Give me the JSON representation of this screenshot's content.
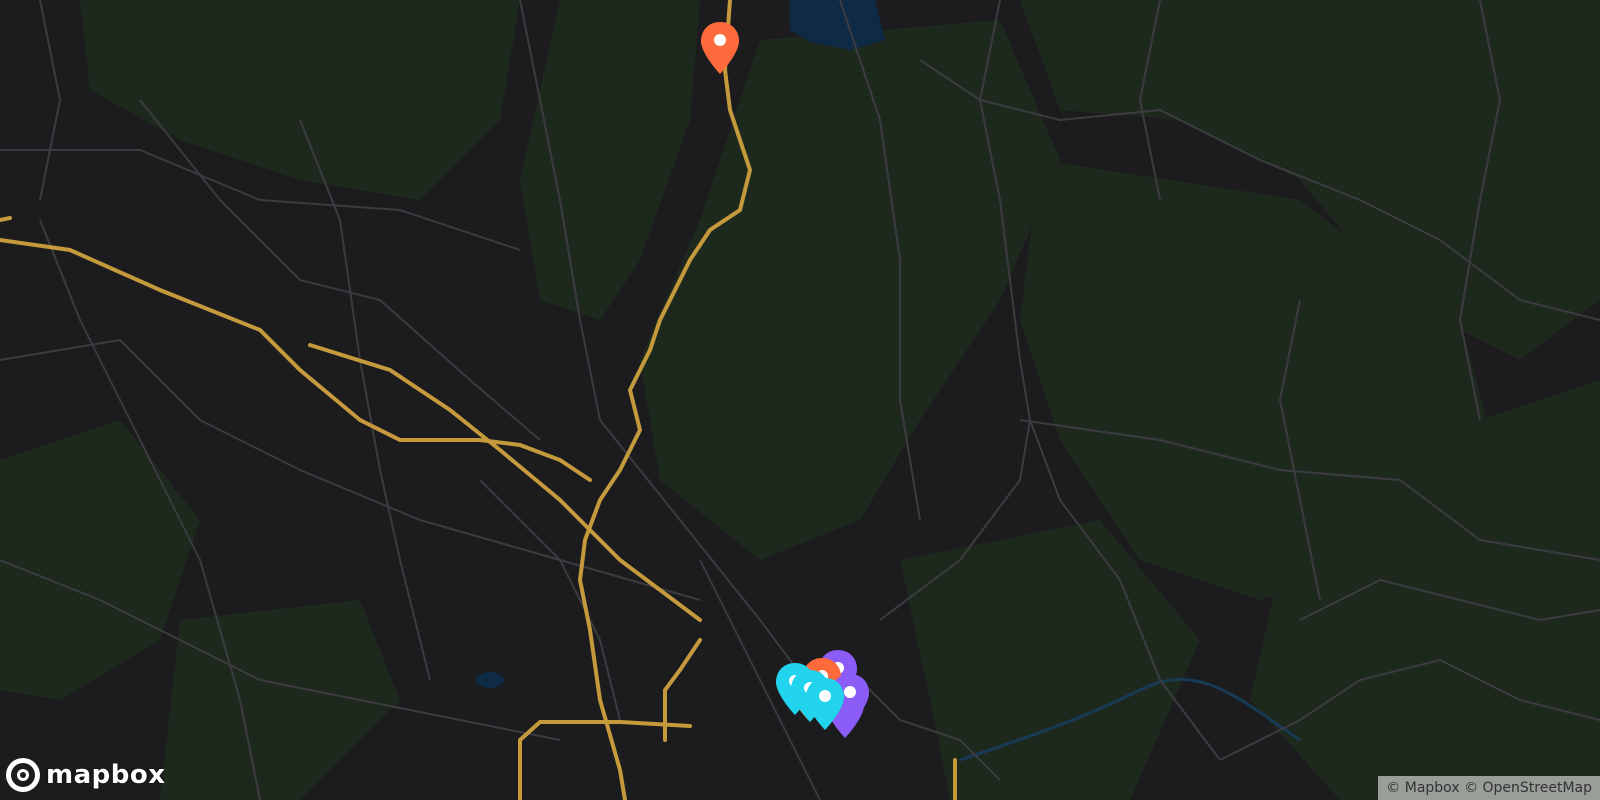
{
  "map": {
    "style": "dark",
    "colors": {
      "background": "#1c1c1e",
      "forest": "#1f2a1f",
      "road_minor": "#3c3c40",
      "road_major": "#c49a3c",
      "water": "#0f2a45"
    }
  },
  "markers": [
    {
      "color": "#ff6a3d",
      "type": "pin"
    },
    {
      "color": "#8b5cf6",
      "type": "pin"
    },
    {
      "color": "#8b5cf6",
      "type": "pin"
    },
    {
      "color": "#ff6a3d",
      "type": "pin"
    },
    {
      "color": "#ff6a3d",
      "type": "pin"
    },
    {
      "color": "#8b5cf6",
      "type": "pin"
    },
    {
      "color": "#22d3ee",
      "type": "pin"
    },
    {
      "color": "#22d3ee",
      "type": "pin"
    },
    {
      "color": "#22d3ee",
      "type": "pin"
    }
  ],
  "logo": {
    "text": "mapbox",
    "icon": "mapbox-logo-icon"
  },
  "attribution": {
    "mapbox": "© Mapbox",
    "osm": "© OpenStreetMap"
  }
}
